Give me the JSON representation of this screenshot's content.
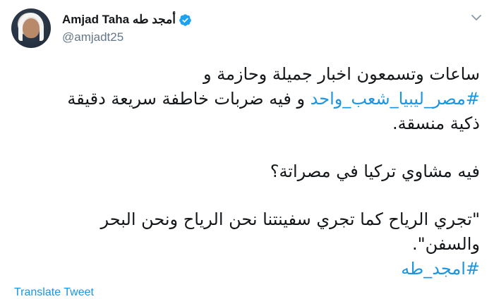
{
  "author": {
    "display_name": "Amjad Taha أمجد طه",
    "handle": "@amjadt25",
    "verified_icon": "verified-badge-icon",
    "avatar_icon": "profile-avatar"
  },
  "tweet": {
    "line1": "ساعات وتسمعون اخبار جميلة وحازمة و",
    "line2_hashtag": "#مصر_ليبيا_شعب_واحد",
    "line2_text": " و فيه ضربات خاطفة سريعة دقيقة",
    "line3": "ذكية منسقة.",
    "line4": "فيه مشاوي تركيا في مصراتة؟",
    "line5": "\"تجري الرياح كما تجري سفينتنا نحن الرياح ونحن البحر",
    "line6": "والسفن\".",
    "line7_hashtag": "#امجد_طه"
  },
  "actions": {
    "translate_label": "Translate Tweet",
    "more_icon": "chevron-down-icon"
  },
  "colors": {
    "link": "#1b95e0",
    "text": "#14171a",
    "secondary": "#657786",
    "verified": "#1da1f2"
  }
}
